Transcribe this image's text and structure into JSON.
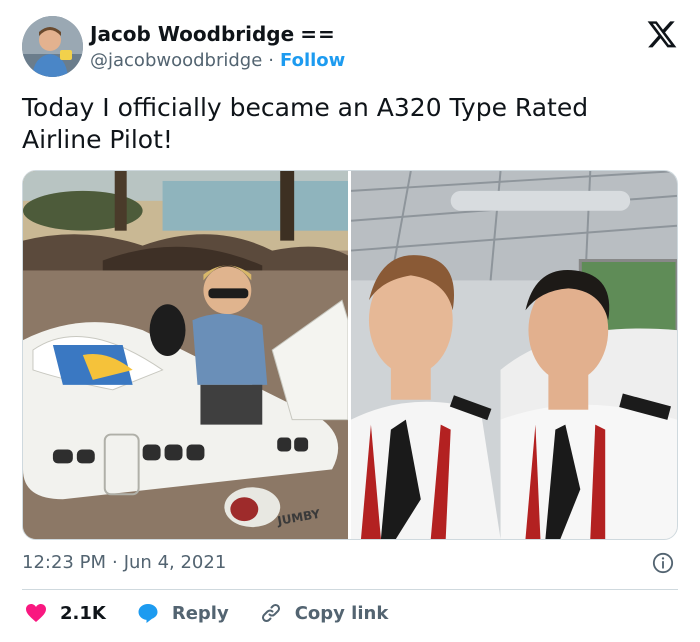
{
  "author": {
    "name": "Jacob Woodbridge",
    "badge": "==",
    "handle": "@jacobwoodbridge",
    "separator": "·",
    "follow_label": "Follow",
    "avatar_icon": "avatar-photo"
  },
  "tweet": {
    "text": "Today I officially became an A320 Type Rated Airline Pilot!"
  },
  "media": {
    "left_photo_icon": "child-toy-plane-photo",
    "left_photo_plane_text": "JUMBY",
    "right_photo_icon": "pilots-selfie-photo"
  },
  "meta": {
    "time": "12:23 PM",
    "separator": "·",
    "date": "Jun 4, 2021",
    "info_icon": "info-icon"
  },
  "actions": {
    "likes": "2.1K",
    "reply_label": "Reply",
    "copy_label": "Copy link"
  },
  "colors": {
    "accent": "#1d9bf0",
    "like": "#f91880",
    "text": "#0f1419",
    "secondary": "#536471",
    "border": "#cfd9de"
  }
}
